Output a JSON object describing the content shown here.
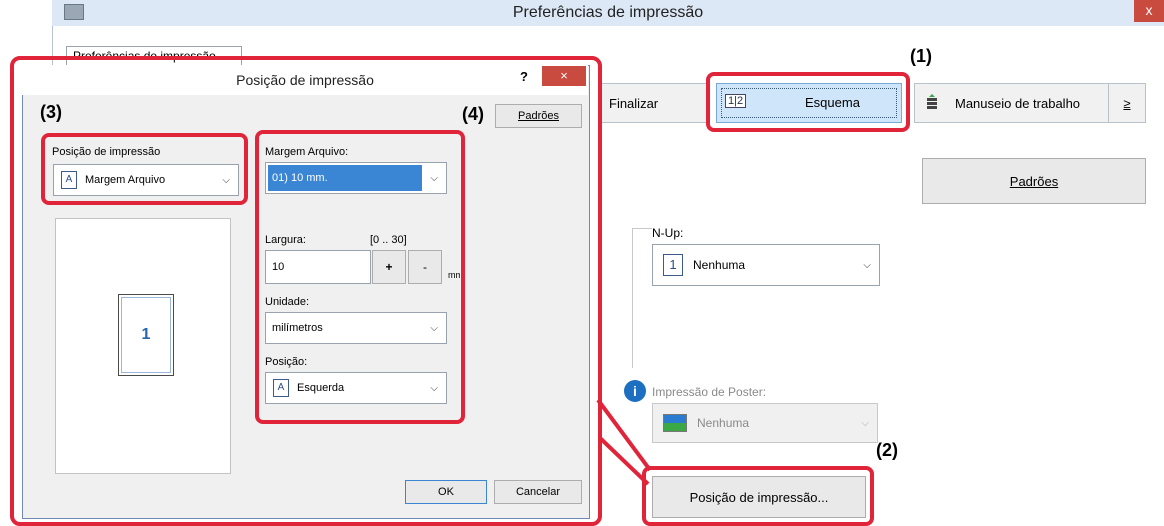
{
  "main_window": {
    "title": "Preferências de impressão",
    "close_glyph": "x",
    "top_tab_label": "Preferências de impressão",
    "tabs": [
      {
        "label": "Finalizar"
      },
      {
        "label": "Esquema",
        "icon_text": "1|2"
      },
      {
        "label": "Manuseio de trabalho"
      },
      {
        "label": "≥"
      }
    ],
    "padroes_button": "Padrões",
    "nup_label": "N-Up:",
    "nup_value": "Nenhuma",
    "nup_icon_text": "1",
    "poster_label": "Impressão de Poster:",
    "poster_value": "Nenhuma",
    "print_position_button": "Posição de impressão..."
  },
  "dialog": {
    "title": "Posição de impressão",
    "help_glyph": "?",
    "close_glyph": "×",
    "padroes_button": "Padrões",
    "print_position_label": "Posição de impressão",
    "print_position_value": "Margem Arquivo",
    "margin_label": "Margem Arquivo:",
    "margin_value": "01) 10 mm.",
    "width_label": "Largura:",
    "width_range": "[0 .. 30]",
    "width_value": "10",
    "width_unit": "mm",
    "plus": "+",
    "minus": "-",
    "unit_label": "Unidade:",
    "unit_value": "milímetros",
    "position_label": "Posição:",
    "position_value": "Esquerda",
    "preview_page_number": "1",
    "ok_button": "OK",
    "cancel_button": "Cancelar"
  },
  "callouts": [
    "(1)",
    "(2)",
    "(3)",
    "(4)"
  ],
  "colors": {
    "callout_red": "#e0243a",
    "selection_blue": "#3a86d4"
  }
}
